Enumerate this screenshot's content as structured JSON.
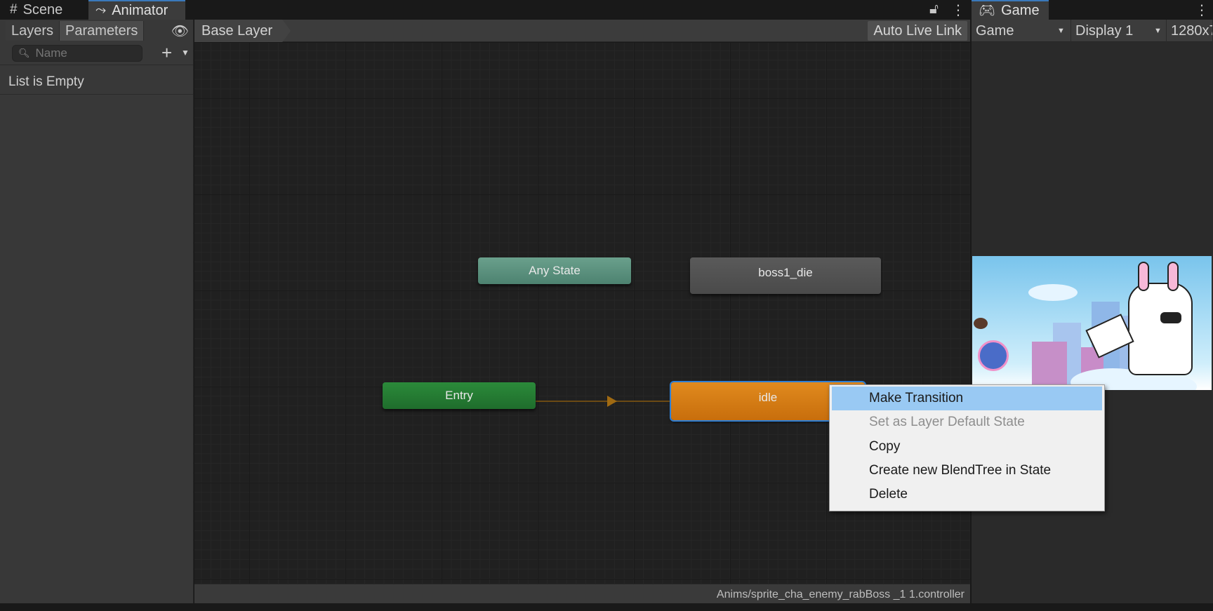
{
  "tabs": {
    "scene": "Scene",
    "animator": "Animator",
    "game": "Game"
  },
  "left_panel": {
    "layers_tab": "Layers",
    "parameters_tab": "Parameters",
    "search_placeholder": "Name",
    "empty_text": "List is Empty"
  },
  "breadcrumb": {
    "layer": "Base Layer",
    "auto_live_link": "Auto Live Link"
  },
  "graph": {
    "nodes": {
      "any_state": "Any State",
      "boss1_die": "boss1_die",
      "entry": "Entry",
      "idle": "idle"
    },
    "footer_path": "Anims/sprite_cha_enemy_rabBoss _1 1.controller"
  },
  "context_menu": {
    "items": [
      {
        "label": "Make Transition",
        "highlighted": true,
        "enabled": true
      },
      {
        "label": "Set as Layer Default State",
        "highlighted": false,
        "enabled": false
      },
      {
        "label": "Copy",
        "highlighted": false,
        "enabled": true
      },
      {
        "label": "Create new BlendTree in State",
        "highlighted": false,
        "enabled": true
      },
      {
        "label": "Delete",
        "highlighted": false,
        "enabled": true
      }
    ]
  },
  "game_toolbar": {
    "view": "Game",
    "display": "Display 1",
    "resolution": "1280x7"
  },
  "icons": {
    "scene": "grid-icon",
    "animator": "animator-icon",
    "game": "gamepad-icon",
    "lock": "lock-icon",
    "more": "kebab-menu-icon",
    "eye": "eye-icon",
    "search": "search-icon",
    "add": "plus-icon"
  },
  "colors": {
    "any_state": "#5a917d",
    "entry": "#26803a",
    "idle": "#d77b14",
    "selection": "#2d7fd6",
    "menu_highlight": "#99c9f3"
  }
}
